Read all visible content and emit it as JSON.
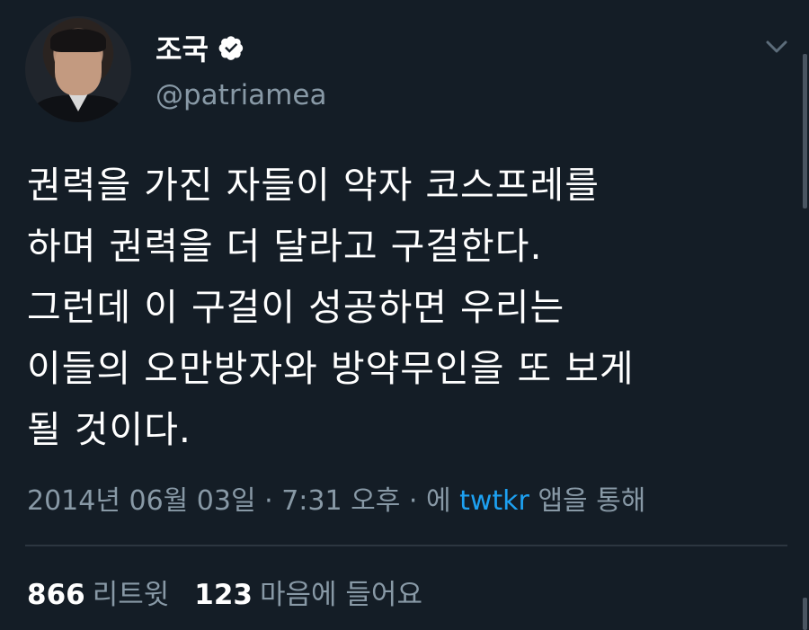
{
  "user": {
    "display_name": "조국",
    "handle": "@patriamea",
    "verified": true
  },
  "tweet": {
    "text": "권력을 가진 자들이 약자 코스프레를\n하며 권력을 더 달라고 구걸한다.\n그런데 이 구걸이 성공하면 우리는\n이들의 오만방자와 방약무인을 또 보게\n될 것이다.",
    "date": "2014년 06월 03일",
    "separator": "·",
    "time": "7:31 오후",
    "via_prefix": "에",
    "app_name": "twtkr",
    "via_suffix": "앱을 통해"
  },
  "stats": {
    "retweets_count": "866",
    "retweets_label": "리트윗",
    "likes_count": "123",
    "likes_label": "마음에 들어요"
  },
  "icons": {
    "verified": "verified-badge-icon",
    "menu": "chevron-down-icon"
  },
  "colors": {
    "background": "#141d26",
    "secondary_text": "#8899a6",
    "link": "#1da1f2"
  }
}
